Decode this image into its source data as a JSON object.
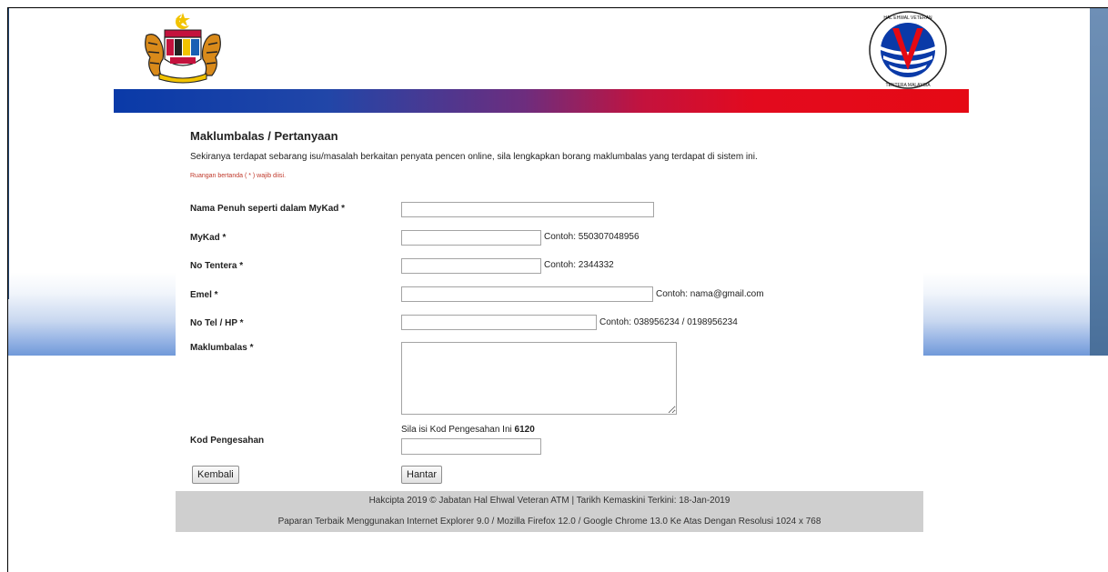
{
  "header": {
    "crest_icon": "malaysia-coat-of-arms",
    "logo_icon": "jabatan-hal-ehwal-veteran-logo",
    "logo_ring_text": "JABATAN HAL EHWAL VETERAN · ANGKATAN TENTERA MALAYSIA"
  },
  "form": {
    "title": "Maklumbalas / Pertanyaan",
    "intro": "Sekiranya terdapat sebarang isu/masalah berkaitan penyata pencen online, sila lengkapkan borang maklumbalas yang terdapat di sistem ini.",
    "mandatory_note": "Ruangan bertanda ( * ) wajib diisi.",
    "fields": {
      "name": {
        "label": "Nama Penuh seperti dalam MyKad *",
        "value": "",
        "hint": ""
      },
      "mykad": {
        "label": "MyKad *",
        "value": "",
        "hint": "Contoh: 550307048956"
      },
      "tentera": {
        "label": "No Tentera *",
        "value": "",
        "hint": "Contoh: 2344332"
      },
      "email": {
        "label": "Emel *",
        "value": "",
        "hint": "Contoh: nama@gmail.com"
      },
      "phone": {
        "label": "No Tel / HP *",
        "value": "",
        "hint": "Contoh: 038956234 / 0198956234"
      },
      "feedback": {
        "label": "Maklumbalas *",
        "value": ""
      },
      "verify": {
        "label": "Kod Pengesahan",
        "instruction": "Sila isi Kod Pengesahan Ini",
        "code": "6120",
        "value": ""
      }
    },
    "buttons": {
      "back": "Kembali",
      "submit": "Hantar"
    }
  },
  "footer": {
    "copyright": "Hakcipta 2019 © Jabatan Hal Ehwal Veteran ATM | Tarikh Kemaskini Terkini: 18-Jan-2019",
    "best_view": "Paparan Terbaik Menggunakan Internet Explorer 9.0 / Mozilla Firefox 12.0 / Google Chrome 13.0 Ke Atas Dengan Resolusi 1024 x 768"
  },
  "colors": {
    "banner_blue": "#0a3aa8",
    "banner_red": "#e50914",
    "mandatory_red": "#c0392b",
    "footer_grey": "#cfcfcf"
  }
}
